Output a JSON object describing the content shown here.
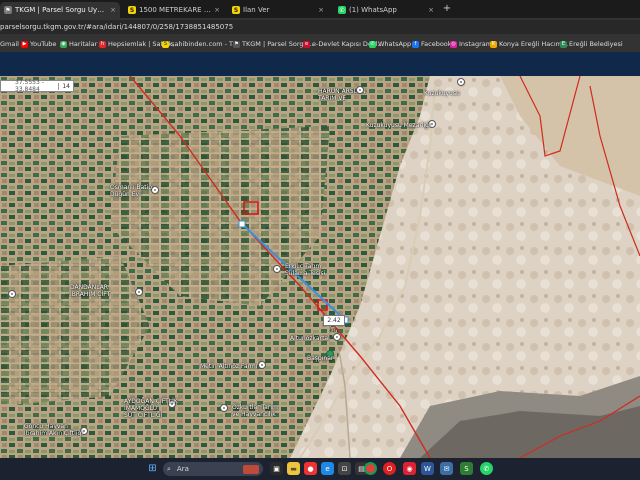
{
  "browser": {
    "tabs": [
      {
        "label": "TKGM | Parsel Sorgu Uygulaması",
        "active": true,
        "icon": "tkgm-icon"
      },
      {
        "label": "1500 METREKARE TEK TAPU İKİ",
        "active": false,
        "icon": "sahibinden-icon"
      },
      {
        "label": "İlan Ver",
        "active": false,
        "icon": "sahibinden-icon"
      },
      {
        "label": "(1) WhatsApp",
        "active": false,
        "icon": "whatsapp-icon"
      }
    ],
    "close_symbol": "×",
    "new_tab_symbol": "+",
    "address": "parselsorgu.tkgm.gov.tr/#ara/idari/144807/0/258/1738851485075",
    "bookmarks": [
      {
        "label": "Gmail",
        "icon": "gmail-icon",
        "color": "#ea4335"
      },
      {
        "label": "YouTube",
        "icon": "youtube-icon",
        "color": "#ff0000"
      },
      {
        "label": "Haritalar",
        "icon": "maps-icon",
        "color": "#34a853"
      },
      {
        "label": "Hepsiemlak | Satılık,...",
        "icon": "hepsiemlak-icon",
        "color": "#e3262f"
      },
      {
        "label": "sahibinden.com - T...",
        "icon": "sahibinden-icon",
        "color": "#f5d500"
      },
      {
        "label": "TKGM | Parsel Sorgu...",
        "icon": "tkgm-icon",
        "color": "#555555"
      },
      {
        "label": "e-Devlet Kapısı Devl...",
        "icon": "edevlet-icon",
        "color": "#c8102e"
      },
      {
        "label": "WhatsApp",
        "icon": "whatsapp-icon",
        "color": "#25d366"
      },
      {
        "label": "Facebook",
        "icon": "facebook-icon",
        "color": "#1877f2"
      },
      {
        "label": "Instagram",
        "icon": "instagram-icon",
        "color": "#d6249f"
      },
      {
        "label": "Konya Ereğli Hacım...",
        "icon": "konya-icon",
        "color": "#f0a500"
      },
      {
        "label": "Ereğli Belediyesi",
        "icon": "belediye-icon",
        "color": "#2e8b57"
      }
    ]
  },
  "map": {
    "coordinates": "37.5553 - 33.8484",
    "zoom": "14",
    "distance": "2.42 km",
    "labels": [
      {
        "text": "HARUN ARSLAN\nTARIM VE",
        "name": "label-harun-arslan"
      },
      {
        "text": "Kuzukuyusu",
        "name": "label-kuzukuyusu"
      },
      {
        "text": "Kuzukuyusu Mezarlığı",
        "name": "label-kuzukuyusu-mezarligi"
      },
      {
        "text": "Osmanlı Batip\nDüğün Evi",
        "name": "label-osmanli"
      },
      {
        "text": "Erkılıç Tarım\nSulama Tesisi",
        "name": "label-erkilic"
      },
      {
        "text": "DANDANLAR\nİBRAHİM ÇİFT",
        "name": "label-dandanlar"
      },
      {
        "text": "Altunözkartal",
        "name": "label-altunozkartal"
      },
      {
        "text": "Başpınar",
        "name": "label-baspinar"
      },
      {
        "text": "Metin Altınöz Farmı",
        "name": "label-metin"
      },
      {
        "text": "AYDOĞAN ÇİFTLİK\nİMAMOĞLU\nSÜT ÇİFTLİĞİ",
        "name": "label-aydogan"
      },
      {
        "text": "Özkurtlar Tarım\nve Hayvancılık",
        "name": "label-ozkurtlar"
      },
      {
        "text": "Göncü Hayvan\nİbrahim Akın Çiftliği",
        "name": "label-goncu"
      }
    ]
  },
  "taskbar": {
    "search_placeholder": "Ara",
    "apps": [
      "start-icon",
      "search-icon",
      "explorer-icon",
      "chrome-icon",
      "edge-icon",
      "store-icon",
      "opera-icon",
      "chrome-icon",
      "word-icon",
      "mail-icon",
      "files-icon",
      "whatsapp-icon"
    ]
  }
}
